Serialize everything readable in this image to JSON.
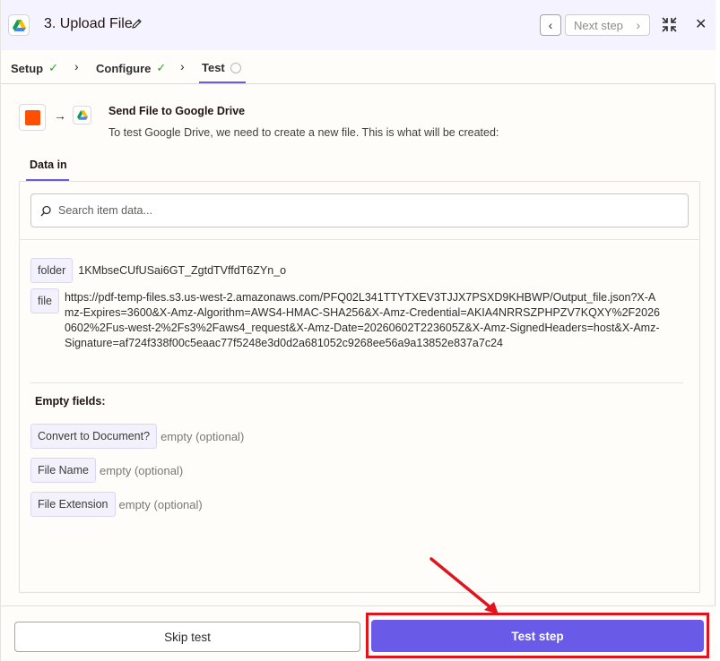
{
  "header": {
    "title": "3. Upload File",
    "next_label": "Next step"
  },
  "tabs": [
    {
      "label": "Setup",
      "status": "complete"
    },
    {
      "label": "Configure",
      "status": "complete"
    },
    {
      "label": "Test",
      "status": "pending"
    }
  ],
  "send": {
    "title": "Send File to Google Drive",
    "subtitle": "To test Google Drive, we need to create a new file. This is what will be created:"
  },
  "data_tab": "Data in",
  "search": {
    "placeholder": "Search item data..."
  },
  "fields": [
    {
      "key": "folder",
      "value": "1KMbseCUfUSai6GT_ZgtdTVffdT6ZYn_o"
    },
    {
      "key": "file",
      "value": "https://pdf-temp-files.s3.us-west-2.amazonaws.com/PFQ02L341TTYTXEV3TJJX7PSXD9KHBWP/Output_file.json?X-Amz-Expires=3600&X-Amz-Algorithm=AWS4-HMAC-SHA256&X-Amz-Credential=AKIA4NRRSZPHPZV7KQXY%2F20260602%2Fus-west-2%2Fs3%2Faws4_request&X-Amz-Date=20260602T223605Z&X-Amz-SignedHeaders=host&X-Amz-Signature=af724f338f00c5eaac77f5248e3d0d2a681052c9268ee56a9a13852e837a7c24"
    }
  ],
  "empty_heading": "Empty fields:",
  "empty_fields": [
    {
      "key": "Convert to Document?",
      "value": "empty (optional)"
    },
    {
      "key": "File Name",
      "value": "empty (optional)"
    },
    {
      "key": "File Extension",
      "value": "empty (optional)"
    }
  ],
  "footer": {
    "skip_label": "Skip test",
    "test_label": "Test step"
  },
  "colors": {
    "accent": "#695be8",
    "zapier_orange": "#ff4f00",
    "annotation_red": "#e0141e",
    "check_green": "#2ca02c"
  },
  "icons": [
    "google-drive-icon",
    "pencil-icon",
    "chevron-left-icon",
    "chevron-right-icon",
    "collapse-icon",
    "close-icon",
    "check-icon",
    "pending-circle-icon",
    "arrow-right-icon",
    "search-icon"
  ]
}
